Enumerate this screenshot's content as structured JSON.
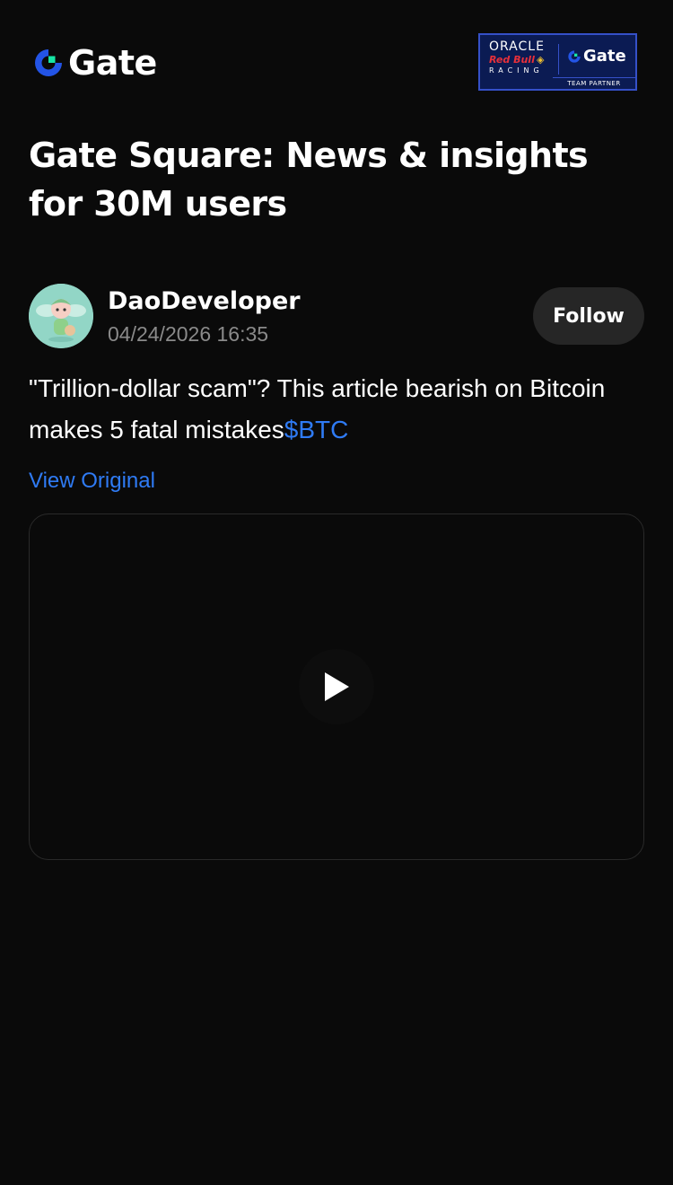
{
  "header": {
    "logo_text": "Gate",
    "partner_badge": {
      "oracle": "ORACLE",
      "redbull": "Red Bull",
      "racing": "RACING",
      "gate": "Gate",
      "team_partner": "TEAM PARTNER"
    }
  },
  "page": {
    "title": "Gate Square: News & insights for 30M users"
  },
  "post": {
    "author": "DaoDeveloper",
    "timestamp": "04/24/2026 16:35",
    "follow_label": "Follow",
    "text": "\"Trillion-dollar scam\"? This article bearish on Bitcoin makes 5 fatal mistakes",
    "ticker": "$BTC",
    "view_original_label": "View Original",
    "video_icon": "play-icon"
  },
  "colors": {
    "background": "#0a0a0a",
    "accent_link": "#2f7bf5",
    "brand_green": "#17e5a5",
    "brand_blue": "#2354e6",
    "muted_text": "#8a8a8a",
    "button_bg": "#262626"
  }
}
